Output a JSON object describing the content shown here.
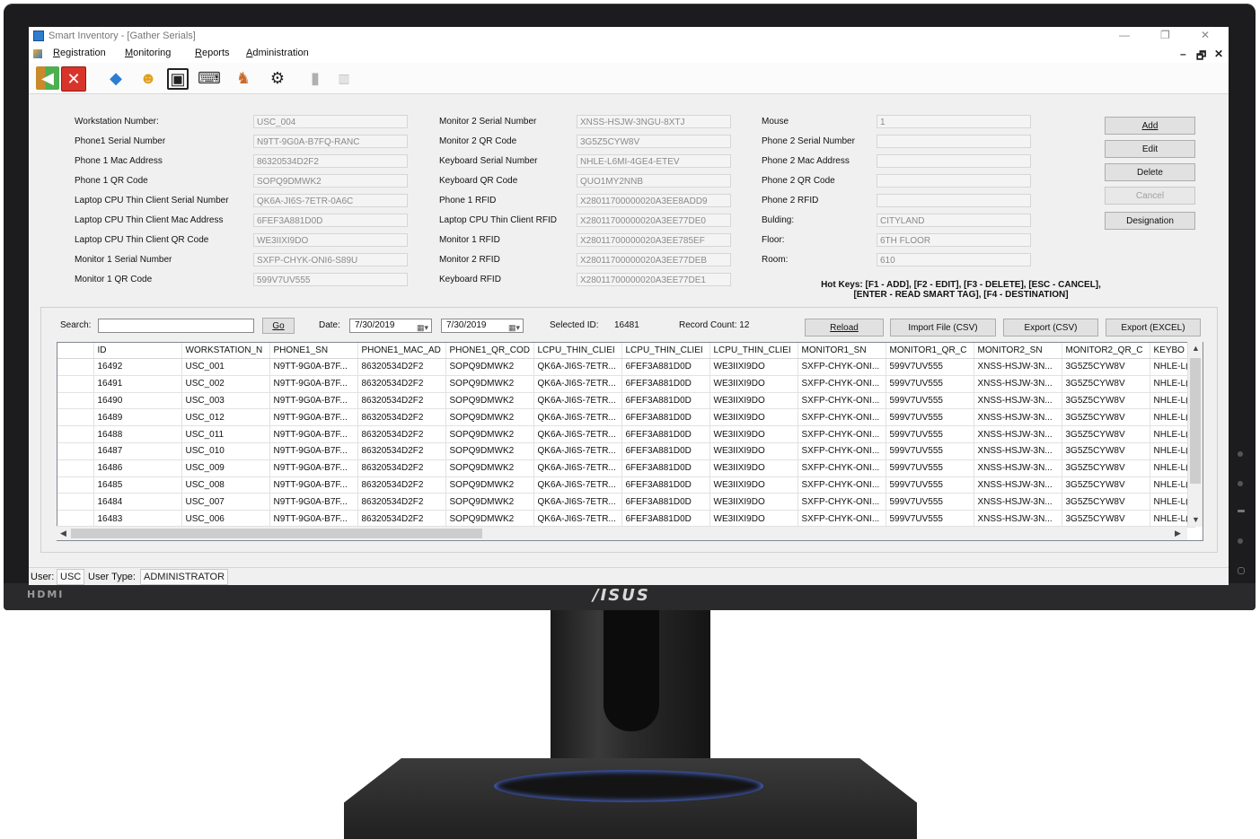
{
  "window": {
    "title": "Smart Inventory - [Gather Serials]",
    "minimize": "—",
    "restore": "❐",
    "close": "✕",
    "mdi_minimize": "–",
    "mdi_restore": "🗗",
    "mdi_close": "✕"
  },
  "menu": [
    "Registration",
    "Monitoring",
    "Reports",
    "Administration"
  ],
  "form": {
    "col1": [
      {
        "label": "Workstation Number:",
        "value": "USC_004"
      },
      {
        "label": "Phone1 Serial Number",
        "value": "N9TT-9G0A-B7FQ-RANC"
      },
      {
        "label": "Phone 1 Mac Address",
        "value": "86320534D2F2"
      },
      {
        "label": "Phone 1 QR Code",
        "value": "SOPQ9DMWK2"
      },
      {
        "label": "Laptop CPU Thin Client Serial Number",
        "value": "QK6A-JI6S-7ETR-0A6C"
      },
      {
        "label": "Laptop CPU Thin Client Mac Address",
        "value": "6FEF3A881D0D"
      },
      {
        "label": "Laptop CPU Thin Client QR Code",
        "value": "WE3IIXI9DO"
      },
      {
        "label": "Monitor 1 Serial Number",
        "value": "SXFP-CHYK-ONI6-S89U"
      },
      {
        "label": "Monitor 1 QR Code",
        "value": "599V7UV555"
      }
    ],
    "col2": [
      {
        "label": "Monitor 2 Serial Number",
        "value": "XNSS-HSJW-3NGU-8XTJ"
      },
      {
        "label": "Monitor 2 QR Code",
        "value": "3G5Z5CYW8V"
      },
      {
        "label": "Keyboard Serial Number",
        "value": "NHLE-L6MI-4GE4-ETEV"
      },
      {
        "label": "Keyboard QR Code",
        "value": "QUO1MY2NNB"
      },
      {
        "label": "Phone 1 RFID",
        "value": "X28011700000020A3EE8ADD9"
      },
      {
        "label": "Laptop CPU Thin Client RFID",
        "value": "X28011700000020A3EE77DE0"
      },
      {
        "label": "Monitor 1 RFID",
        "value": "X28011700000020A3EE785EF"
      },
      {
        "label": "Monitor 2 RFID",
        "value": "X28011700000020A3EE77DEB"
      },
      {
        "label": "Keyboard RFID",
        "value": "X28011700000020A3EE77DE1"
      }
    ],
    "col3": [
      {
        "label": "Mouse",
        "value": "1"
      },
      {
        "label": "Phone 2 Serial Number",
        "value": ""
      },
      {
        "label": "Phone 2 Mac Address",
        "value": ""
      },
      {
        "label": "Phone 2 QR Code",
        "value": ""
      },
      {
        "label": "Phone 2 RFID",
        "value": ""
      },
      {
        "label": "Bulding:",
        "value": "CITYLAND"
      },
      {
        "label": "Floor:",
        "value": "6TH FLOOR"
      },
      {
        "label": "Room:",
        "value": "610"
      }
    ],
    "buttons": [
      "Add",
      "Edit",
      "Delete",
      "Cancel",
      "Designation"
    ],
    "hotkeys_line1": "Hot Keys: [F1 - ADD], [F2 - EDIT], [F3 - DELETE], [ESC - CANCEL],",
    "hotkeys_line2": "[ENTER - READ SMART TAG], [F4 - DESTINATION]"
  },
  "search": {
    "label": "Search:",
    "value": "",
    "go": "Go",
    "date_label": "Date:",
    "date_from": "7/30/2019",
    "date_to": "7/30/2019",
    "selected_id_label": "Selected ID:",
    "selected_id": "16481",
    "record_count": "Record Count: 12",
    "reload": "Reload",
    "import": "Import File (CSV)",
    "export_csv": "Export (CSV)",
    "export_excel": "Export (EXCEL)"
  },
  "grid": {
    "columns": [
      "ID",
      "WORKSTATION_N",
      "PHONE1_SN",
      "PHONE1_MAC_AD",
      "PHONE1_QR_COD",
      "LCPU_THIN_CLIEI",
      "LCPU_THIN_CLIEI",
      "LCPU_THIN_CLIEI",
      "MONITOR1_SN",
      "MONITOR1_QR_C",
      "MONITOR2_SN",
      "MONITOR2_QR_C",
      "KEYBO"
    ],
    "rows": [
      [
        "16492",
        "USC_001",
        "N9TT-9G0A-B7F...",
        "86320534D2F2",
        "SOPQ9DMWK2",
        "QK6A-JI6S-7ETR...",
        "6FEF3A881D0D",
        "WE3IIXI9DO",
        "SXFP-CHYK-ONI...",
        "599V7UV555",
        "XNSS-HSJW-3N...",
        "3G5Z5CYW8V",
        "NHLE-L("
      ],
      [
        "16491",
        "USC_002",
        "N9TT-9G0A-B7F...",
        "86320534D2F2",
        "SOPQ9DMWK2",
        "QK6A-JI6S-7ETR...",
        "6FEF3A881D0D",
        "WE3IIXI9DO",
        "SXFP-CHYK-ONI...",
        "599V7UV555",
        "XNSS-HSJW-3N...",
        "3G5Z5CYW8V",
        "NHLE-L("
      ],
      [
        "16490",
        "USC_003",
        "N9TT-9G0A-B7F...",
        "86320534D2F2",
        "SOPQ9DMWK2",
        "QK6A-JI6S-7ETR...",
        "6FEF3A881D0D",
        "WE3IIXI9DO",
        "SXFP-CHYK-ONI...",
        "599V7UV555",
        "XNSS-HSJW-3N...",
        "3G5Z5CYW8V",
        "NHLE-L("
      ],
      [
        "16489",
        "USC_012",
        "N9TT-9G0A-B7F...",
        "86320534D2F2",
        "SOPQ9DMWK2",
        "QK6A-JI6S-7ETR...",
        "6FEF3A881D0D",
        "WE3IIXI9DO",
        "SXFP-CHYK-ONI...",
        "599V7UV555",
        "XNSS-HSJW-3N...",
        "3G5Z5CYW8V",
        "NHLE-L("
      ],
      [
        "16488",
        "USC_011",
        "N9TT-9G0A-B7F...",
        "86320534D2F2",
        "SOPQ9DMWK2",
        "QK6A-JI6S-7ETR...",
        "6FEF3A881D0D",
        "WE3IIXI9DO",
        "SXFP-CHYK-ONI...",
        "599V7UV555",
        "XNSS-HSJW-3N...",
        "3G5Z5CYW8V",
        "NHLE-L("
      ],
      [
        "16487",
        "USC_010",
        "N9TT-9G0A-B7F...",
        "86320534D2F2",
        "SOPQ9DMWK2",
        "QK6A-JI6S-7ETR...",
        "6FEF3A881D0D",
        "WE3IIXI9DO",
        "SXFP-CHYK-ONI...",
        "599V7UV555",
        "XNSS-HSJW-3N...",
        "3G5Z5CYW8V",
        "NHLE-L("
      ],
      [
        "16486",
        "USC_009",
        "N9TT-9G0A-B7F...",
        "86320534D2F2",
        "SOPQ9DMWK2",
        "QK6A-JI6S-7ETR...",
        "6FEF3A881D0D",
        "WE3IIXI9DO",
        "SXFP-CHYK-ONI...",
        "599V7UV555",
        "XNSS-HSJW-3N...",
        "3G5Z5CYW8V",
        "NHLE-L("
      ],
      [
        "16485",
        "USC_008",
        "N9TT-9G0A-B7F...",
        "86320534D2F2",
        "SOPQ9DMWK2",
        "QK6A-JI6S-7ETR...",
        "6FEF3A881D0D",
        "WE3IIXI9DO",
        "SXFP-CHYK-ONI...",
        "599V7UV555",
        "XNSS-HSJW-3N...",
        "3G5Z5CYW8V",
        "NHLE-L("
      ],
      [
        "16484",
        "USC_007",
        "N9TT-9G0A-B7F...",
        "86320534D2F2",
        "SOPQ9DMWK2",
        "QK6A-JI6S-7ETR...",
        "6FEF3A881D0D",
        "WE3IIXI9DO",
        "SXFP-CHYK-ONI...",
        "599V7UV555",
        "XNSS-HSJW-3N...",
        "3G5Z5CYW8V",
        "NHLE-L("
      ],
      [
        "16483",
        "USC_006",
        "N9TT-9G0A-B7F...",
        "86320534D2F2",
        "SOPQ9DMWK2",
        "QK6A-JI6S-7ETR...",
        "6FEF3A881D0D",
        "WE3IIXI9DO",
        "SXFP-CHYK-ONI...",
        "599V7UV555",
        "XNSS-HSJW-3N...",
        "3G5Z5CYW8V",
        "NHLE-L("
      ]
    ]
  },
  "status": {
    "user_label": "User:",
    "user": "USC",
    "type_label": "User Type:",
    "type": "ADMINISTRATOR"
  },
  "monitor": {
    "port_label": "HDMI",
    "brand": "/ISUS"
  },
  "toolbar_icons": [
    "exit-icon",
    "close-red-icon",
    "workstation-icon",
    "users-icon",
    "rfid-reader-icon",
    "scanner-icon",
    "user-transfer-icon",
    "security-icon",
    "server-icon",
    "report-chart-icon"
  ],
  "colors": {
    "accent": "#2d7dd2",
    "close_red": "#d9342b"
  }
}
